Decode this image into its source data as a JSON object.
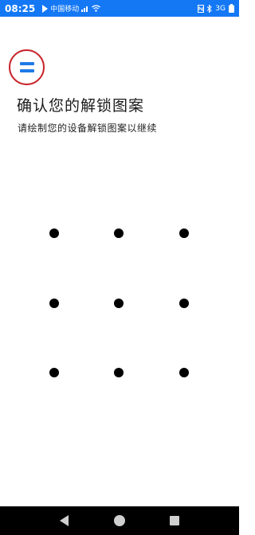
{
  "status_bar": {
    "time": "08:25",
    "carrier": "中国移动",
    "right_text": "3G",
    "icons": [
      "notification-icon",
      "signal-icon",
      "wifi-icon",
      "nfc-icon",
      "bluetooth-icon",
      "battery-icon"
    ]
  },
  "header": {
    "menu_icon": "menu-icon"
  },
  "content": {
    "title": "确认您的解锁图案",
    "subtitle": "请绘制您的设备解锁图案以继续"
  },
  "pattern": {
    "rows": 3,
    "cols": 3
  },
  "nav_bar": {
    "buttons": [
      "back-icon",
      "home-icon",
      "recents-icon"
    ]
  }
}
